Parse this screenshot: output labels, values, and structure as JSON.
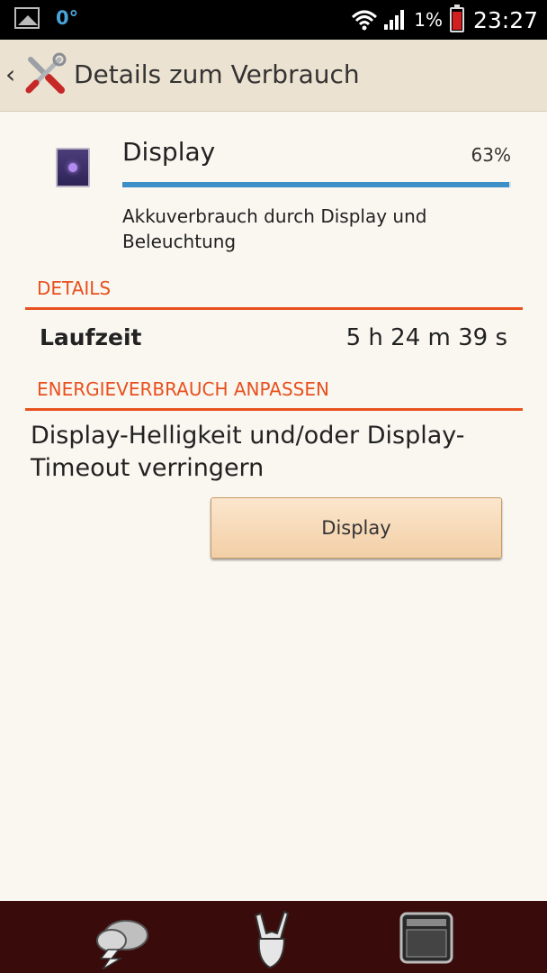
{
  "status_bar": {
    "temperature": "0°",
    "battery_percent": "1%",
    "time": "23:27",
    "icons": [
      "gallery-icon",
      "wifi-icon",
      "signal-icon",
      "battery-icon"
    ]
  },
  "action_bar": {
    "title": "Details zum Verbrauch",
    "icons": [
      "back-chevron-icon",
      "tools-icon"
    ]
  },
  "item": {
    "icon": "display-app-icon",
    "title": "Display",
    "percent_label": "63%",
    "usage_fraction": 0.995,
    "description": "Akkuverbrauch durch Display und Beleuchtung"
  },
  "details": {
    "header": "DETAILS",
    "runtime_label": "Laufzeit",
    "runtime_value": "5 h 24 m 39 s"
  },
  "adjust": {
    "header": "ENERGIEVERBRAUCH ANPASSEN",
    "suggestion": "Display-Helligkeit und/oder Display-Timeout verringern",
    "button_label": "Display"
  },
  "dock": {
    "icons": [
      "weather-cloud-icon",
      "rock-hand-icon",
      "amplifier-icon"
    ]
  },
  "colors": {
    "accent": "#e8501e",
    "progress": "#3d8fc7",
    "action_bar": "#ece2d1",
    "dock": "#3a0b0b"
  }
}
